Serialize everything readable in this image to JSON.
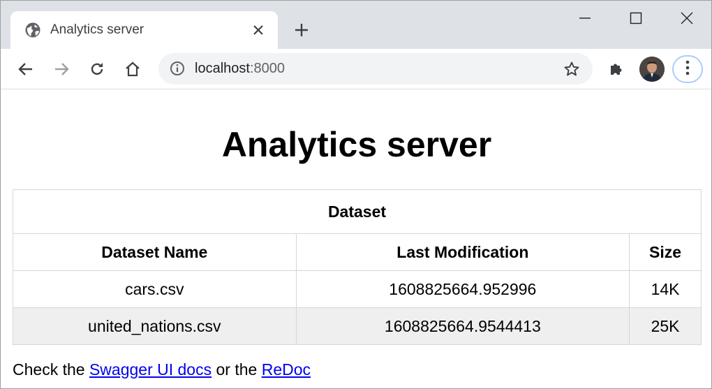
{
  "browser": {
    "tab": {
      "title": "Analytics server",
      "favicon": "globe-icon",
      "close_icon": "close-icon"
    },
    "new_tab_icon": "plus-icon",
    "window_controls": [
      "minimize-icon",
      "maximize-icon",
      "close-icon"
    ],
    "address_bar": {
      "host": "localhost",
      "port": ":8000"
    },
    "colors": {
      "tabstrip": "#dee1e6",
      "omnibox": "#f1f3f4",
      "focus_ring": "#aecbfa",
      "link": "#0000ee"
    }
  },
  "page": {
    "heading": "Analytics server",
    "table": {
      "caption": "Dataset",
      "columns": [
        "Dataset Name",
        "Last Modification",
        "Size"
      ],
      "rows": [
        [
          "cars.csv",
          "1608825664.952996",
          "14K"
        ],
        [
          "united_nations.csv",
          "1608825664.9544413",
          "25K"
        ]
      ]
    },
    "footer": {
      "prefix": "Check the ",
      "link1": "Swagger UI docs",
      "middle": " or the ",
      "link2": "ReDoc"
    }
  }
}
